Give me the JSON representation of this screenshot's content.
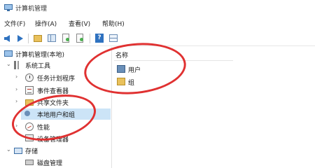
{
  "window": {
    "title": "计算机管理"
  },
  "menu": [
    "文件(F)",
    "操作(A)",
    "查看(V)",
    "帮助(H)"
  ],
  "toolbar": {
    "icons": [
      "back-icon",
      "forward-icon",
      "up-folder-icon",
      "show-tree-icon",
      "export-list-icon",
      "help-icon",
      "properties-icon"
    ]
  },
  "tree": {
    "root": "计算机管理(本地)",
    "system_tools": "系统工具",
    "task_scheduler": "任务计划程序",
    "event_viewer": "事件查看器",
    "shared_folders": "共享文件夹",
    "local_users": "本地用户和组",
    "performance": "性能",
    "device_manager": "设备管理器",
    "storage": "存储",
    "disk_management": "磁盘管理"
  },
  "list": {
    "column_name": "名称",
    "items": [
      "用户",
      "组"
    ]
  },
  "colors": {
    "annotation": "#e03131",
    "selection": "#cce4f7"
  }
}
